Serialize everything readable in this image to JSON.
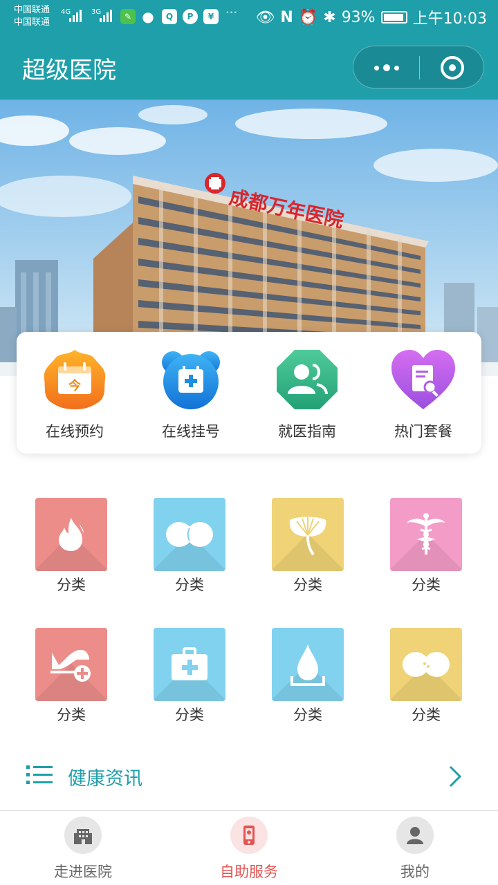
{
  "status_bar": {
    "carrier_1": "中国联通",
    "carrier_2": "中国联通",
    "network_1": "4G",
    "network_2": "3G",
    "more_indicator": "···",
    "battery": "93%",
    "time": "上午10:03",
    "icons": [
      "eye-icon",
      "nfc-icon",
      "alarm-icon",
      "bluetooth-icon",
      "battery-icon"
    ]
  },
  "header": {
    "title": "超级医院",
    "more_button": "more-dots-icon",
    "close_button": "target-icon"
  },
  "banner": {
    "hospital_sign": "成都万年医院",
    "colors": {
      "sky": "#8fc4e8",
      "building_wall": "#c79a6a",
      "sign": "#d8262c"
    }
  },
  "quick_menu": [
    {
      "label": "在线预约",
      "icon": "calendar-icon",
      "color": "#f59a1d"
    },
    {
      "label": "在线挂号",
      "icon": "medical-calendar-icon",
      "color": "#1e8fe0"
    },
    {
      "label": "就医指南",
      "icon": "users-icon",
      "color": "#39b98a"
    },
    {
      "label": "热门套餐",
      "icon": "document-search-icon",
      "color": "#b45ce6"
    }
  ],
  "icon_glyphs": {
    "calendar_day": "今"
  },
  "categories": [
    {
      "label": "分类",
      "icon": "flame-icon",
      "color": "#ec8d8a"
    },
    {
      "label": "分类",
      "icon": "seed-icon",
      "color": "#80d2ef"
    },
    {
      "label": "分类",
      "icon": "ginkgo-icon",
      "color": "#f0d377"
    },
    {
      "label": "分类",
      "icon": "caduceus-icon",
      "color": "#f49cc8"
    },
    {
      "label": "分类",
      "icon": "heartbeat-plus-icon",
      "color": "#ec8d8a"
    },
    {
      "label": "分类",
      "icon": "first-aid-kit-icon",
      "color": "#80d2ef"
    },
    {
      "label": "分类",
      "icon": "water-drop-icon",
      "color": "#80d2ef"
    },
    {
      "label": "分类",
      "icon": "seed-icon",
      "color": "#f0d377"
    }
  ],
  "news": {
    "title": "健康资讯",
    "icon": "list-icon",
    "arrow": "chevron-right-icon",
    "color": "#1e9faa"
  },
  "tabbar": [
    {
      "label": "走进医院",
      "icon": "building-icon",
      "active": false
    },
    {
      "label": "自助服务",
      "icon": "phone-icon",
      "active": true
    },
    {
      "label": "我的",
      "icon": "user-icon",
      "active": false
    }
  ],
  "theme": {
    "primary": "#1e9faa",
    "active_tab": "#e25452"
  }
}
